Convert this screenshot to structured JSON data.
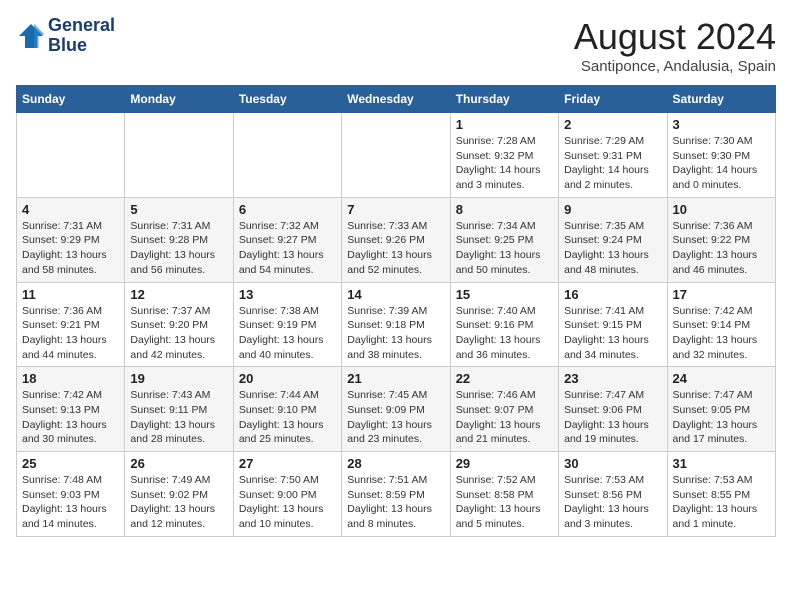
{
  "header": {
    "logo_line1": "General",
    "logo_line2": "Blue",
    "month": "August 2024",
    "location": "Santiponce, Andalusia, Spain"
  },
  "weekdays": [
    "Sunday",
    "Monday",
    "Tuesday",
    "Wednesday",
    "Thursday",
    "Friday",
    "Saturday"
  ],
  "weeks": [
    [
      {
        "day": "",
        "info": ""
      },
      {
        "day": "",
        "info": ""
      },
      {
        "day": "",
        "info": ""
      },
      {
        "day": "",
        "info": ""
      },
      {
        "day": "1",
        "info": "Sunrise: 7:28 AM\nSunset: 9:32 PM\nDaylight: 14 hours\nand 3 minutes."
      },
      {
        "day": "2",
        "info": "Sunrise: 7:29 AM\nSunset: 9:31 PM\nDaylight: 14 hours\nand 2 minutes."
      },
      {
        "day": "3",
        "info": "Sunrise: 7:30 AM\nSunset: 9:30 PM\nDaylight: 14 hours\nand 0 minutes."
      }
    ],
    [
      {
        "day": "4",
        "info": "Sunrise: 7:31 AM\nSunset: 9:29 PM\nDaylight: 13 hours\nand 58 minutes."
      },
      {
        "day": "5",
        "info": "Sunrise: 7:31 AM\nSunset: 9:28 PM\nDaylight: 13 hours\nand 56 minutes."
      },
      {
        "day": "6",
        "info": "Sunrise: 7:32 AM\nSunset: 9:27 PM\nDaylight: 13 hours\nand 54 minutes."
      },
      {
        "day": "7",
        "info": "Sunrise: 7:33 AM\nSunset: 9:26 PM\nDaylight: 13 hours\nand 52 minutes."
      },
      {
        "day": "8",
        "info": "Sunrise: 7:34 AM\nSunset: 9:25 PM\nDaylight: 13 hours\nand 50 minutes."
      },
      {
        "day": "9",
        "info": "Sunrise: 7:35 AM\nSunset: 9:24 PM\nDaylight: 13 hours\nand 48 minutes."
      },
      {
        "day": "10",
        "info": "Sunrise: 7:36 AM\nSunset: 9:22 PM\nDaylight: 13 hours\nand 46 minutes."
      }
    ],
    [
      {
        "day": "11",
        "info": "Sunrise: 7:36 AM\nSunset: 9:21 PM\nDaylight: 13 hours\nand 44 minutes."
      },
      {
        "day": "12",
        "info": "Sunrise: 7:37 AM\nSunset: 9:20 PM\nDaylight: 13 hours\nand 42 minutes."
      },
      {
        "day": "13",
        "info": "Sunrise: 7:38 AM\nSunset: 9:19 PM\nDaylight: 13 hours\nand 40 minutes."
      },
      {
        "day": "14",
        "info": "Sunrise: 7:39 AM\nSunset: 9:18 PM\nDaylight: 13 hours\nand 38 minutes."
      },
      {
        "day": "15",
        "info": "Sunrise: 7:40 AM\nSunset: 9:16 PM\nDaylight: 13 hours\nand 36 minutes."
      },
      {
        "day": "16",
        "info": "Sunrise: 7:41 AM\nSunset: 9:15 PM\nDaylight: 13 hours\nand 34 minutes."
      },
      {
        "day": "17",
        "info": "Sunrise: 7:42 AM\nSunset: 9:14 PM\nDaylight: 13 hours\nand 32 minutes."
      }
    ],
    [
      {
        "day": "18",
        "info": "Sunrise: 7:42 AM\nSunset: 9:13 PM\nDaylight: 13 hours\nand 30 minutes."
      },
      {
        "day": "19",
        "info": "Sunrise: 7:43 AM\nSunset: 9:11 PM\nDaylight: 13 hours\nand 28 minutes."
      },
      {
        "day": "20",
        "info": "Sunrise: 7:44 AM\nSunset: 9:10 PM\nDaylight: 13 hours\nand 25 minutes."
      },
      {
        "day": "21",
        "info": "Sunrise: 7:45 AM\nSunset: 9:09 PM\nDaylight: 13 hours\nand 23 minutes."
      },
      {
        "day": "22",
        "info": "Sunrise: 7:46 AM\nSunset: 9:07 PM\nDaylight: 13 hours\nand 21 minutes."
      },
      {
        "day": "23",
        "info": "Sunrise: 7:47 AM\nSunset: 9:06 PM\nDaylight: 13 hours\nand 19 minutes."
      },
      {
        "day": "24",
        "info": "Sunrise: 7:47 AM\nSunset: 9:05 PM\nDaylight: 13 hours\nand 17 minutes."
      }
    ],
    [
      {
        "day": "25",
        "info": "Sunrise: 7:48 AM\nSunset: 9:03 PM\nDaylight: 13 hours\nand 14 minutes."
      },
      {
        "day": "26",
        "info": "Sunrise: 7:49 AM\nSunset: 9:02 PM\nDaylight: 13 hours\nand 12 minutes."
      },
      {
        "day": "27",
        "info": "Sunrise: 7:50 AM\nSunset: 9:00 PM\nDaylight: 13 hours\nand 10 minutes."
      },
      {
        "day": "28",
        "info": "Sunrise: 7:51 AM\nSunset: 8:59 PM\nDaylight: 13 hours\nand 8 minutes."
      },
      {
        "day": "29",
        "info": "Sunrise: 7:52 AM\nSunset: 8:58 PM\nDaylight: 13 hours\nand 5 minutes."
      },
      {
        "day": "30",
        "info": "Sunrise: 7:53 AM\nSunset: 8:56 PM\nDaylight: 13 hours\nand 3 minutes."
      },
      {
        "day": "31",
        "info": "Sunrise: 7:53 AM\nSunset: 8:55 PM\nDaylight: 13 hours\nand 1 minute."
      }
    ]
  ]
}
